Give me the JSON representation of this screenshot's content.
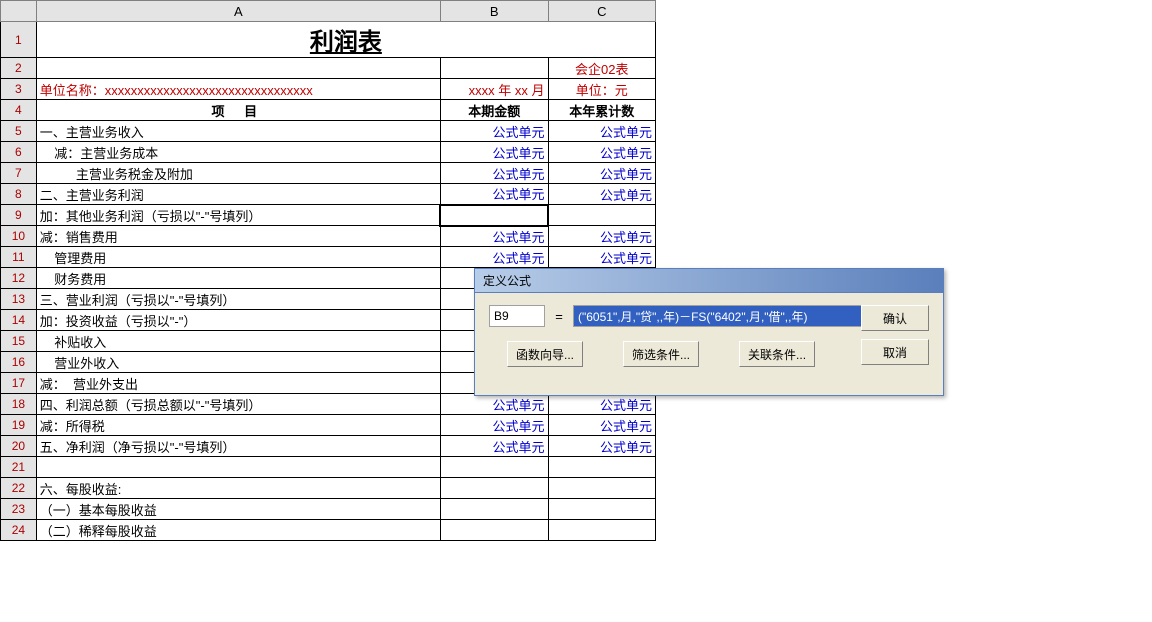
{
  "columns": [
    "A",
    "B",
    "C"
  ],
  "title": "利润表",
  "form_code": "会企02表",
  "unit_prefix": "单位名称：",
  "unit_name": "xxxxxxxxxxxxxxxxxxxxxxxxxxxxxxxx",
  "date_text": "xxxx 年 xx 月",
  "currency": "单位：元",
  "headers": {
    "item": "项       目",
    "current": "本期金额",
    "ytd": "本年累计数"
  },
  "link_label": "公式单元",
  "rows": [
    {
      "n": 1
    },
    {
      "n": 2
    },
    {
      "n": 3
    },
    {
      "n": 4
    },
    {
      "n": 5,
      "a": "一、主营业务收入",
      "b": true,
      "c": true
    },
    {
      "n": 6,
      "a": "    减：主营业务成本",
      "b": true,
      "c": true
    },
    {
      "n": 7,
      "a": "          主营业务税金及附加",
      "b": true,
      "c": true
    },
    {
      "n": 8,
      "a": "二、主营业务利润",
      "b": true,
      "c": true
    },
    {
      "n": 9,
      "a": "加：其他业务利润（亏损以\"-\"号填列）",
      "selected_b": true
    },
    {
      "n": 10,
      "a": "减：销售费用",
      "b": true,
      "c": true
    },
    {
      "n": 11,
      "a": "    管理费用",
      "b": true,
      "c": true
    },
    {
      "n": 12,
      "a": "    财务费用"
    },
    {
      "n": 13,
      "a": "三、营业利润（亏损以\"-\"号填列）"
    },
    {
      "n": 14,
      "a": "加：投资收益（亏损以\"-\"）"
    },
    {
      "n": 15,
      "a": "    补贴收入"
    },
    {
      "n": 16,
      "a": "    营业外收入"
    },
    {
      "n": 17,
      "a": "减：  营业外支出",
      "b": true,
      "c": true
    },
    {
      "n": 18,
      "a": "四、利润总额（亏损总额以\"-\"号填列）",
      "b": true,
      "c": true
    },
    {
      "n": 19,
      "a": "减：所得税",
      "b": true,
      "c": true
    },
    {
      "n": 20,
      "a": "五、净利润（净亏损以\"-\"号填列）",
      "b": true,
      "c": true
    },
    {
      "n": 21,
      "a": ""
    },
    {
      "n": 22,
      "a": "六、每股收益:"
    },
    {
      "n": 23,
      "a": "（一）基本每股收益"
    },
    {
      "n": 24,
      "a": "（二）稀释每股收益"
    }
  ],
  "dialog": {
    "title": "定义公式",
    "cell_ref": "B9",
    "eq": "=",
    "formula": "(\"6051\",月,\"贷\",,年)－FS(\"6402\",月,\"借\",,年)",
    "buttons": {
      "func_wizard": "函数向导...",
      "filter": "筛选条件...",
      "relate": "关联条件...",
      "ok": "确认",
      "cancel": "取消"
    }
  }
}
